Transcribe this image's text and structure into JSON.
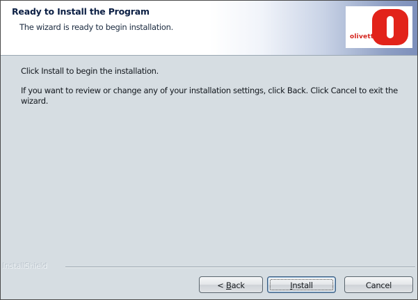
{
  "header": {
    "title": "Ready to Install the Program",
    "subtitle": "The wizard is ready to begin installation.",
    "logo": {
      "text": "olivetti",
      "icon": "olivetti-logo-icon",
      "color": "#e2231a"
    }
  },
  "content": {
    "line1": "Click Install to begin the installation.",
    "line2": "If you want to review or change any of your installation settings, click Back. Click Cancel to exit the wizard."
  },
  "footer": {
    "brand": "InstallShield"
  },
  "buttons": {
    "back": {
      "prefix": "< ",
      "mnemonic": "B",
      "rest": "ack"
    },
    "install": {
      "mnemonic": "I",
      "rest": "nstall"
    },
    "cancel": {
      "label": "Cancel"
    }
  },
  "colors": {
    "background": "#d6dde2",
    "header_background": "#ffffff",
    "title_color": "#0b1f44"
  }
}
